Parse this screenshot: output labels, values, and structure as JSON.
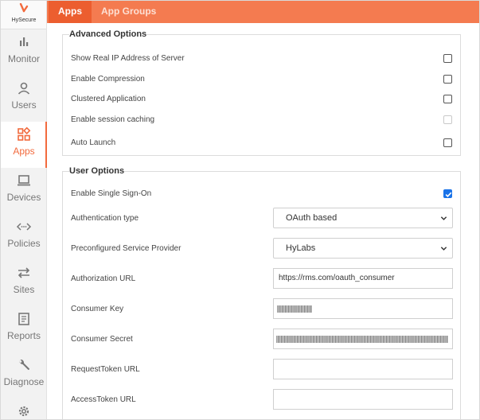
{
  "brand": {
    "name": "HySecure"
  },
  "sidebar": {
    "items": [
      {
        "label": "Monitor",
        "icon": "bar-chart-icon"
      },
      {
        "label": "Users",
        "icon": "user-icon"
      },
      {
        "label": "Apps",
        "icon": "apps-icon",
        "active": true
      },
      {
        "label": "Devices",
        "icon": "laptop-icon"
      },
      {
        "label": "Policies",
        "icon": "code-arrows-icon"
      },
      {
        "label": "Sites",
        "icon": "swap-arrows-icon"
      },
      {
        "label": "Reports",
        "icon": "document-icon"
      },
      {
        "label": "Diagnose",
        "icon": "wrench-icon"
      }
    ]
  },
  "tabs": [
    {
      "label": "Apps",
      "active": true
    },
    {
      "label": "App Groups",
      "active": false
    }
  ],
  "advanced": {
    "title": "Advanced Options",
    "rows": [
      {
        "label": "Show Real IP Address of Server",
        "checked": false,
        "disabled": false
      },
      {
        "label": "Enable Compression",
        "checked": false,
        "disabled": false
      },
      {
        "label": "Clustered Application",
        "checked": false,
        "disabled": false
      },
      {
        "label": "Enable session caching",
        "checked": false,
        "disabled": true
      },
      {
        "label": "Auto Launch",
        "checked": false,
        "disabled": false
      }
    ]
  },
  "user_options": {
    "title": "User Options",
    "sso_label": "Enable Single Sign-On",
    "sso_checked": true,
    "auth_type_label": "Authentication type",
    "auth_type_value": "OAuth based",
    "provider_label": "Preconfigured Service Provider",
    "provider_value": "HyLabs",
    "auth_url_label": "Authorization URL",
    "auth_url_value": "https://rms.com/oauth_consumer",
    "consumer_key_label": "Consumer Key",
    "consumer_secret_label": "Consumer Secret",
    "request_token_label": "RequestToken URL",
    "request_token_value": "",
    "access_token_label": "AccessToken URL",
    "access_token_value": ""
  },
  "colors": {
    "accent": "#f47b50",
    "accent_dark": "#ec5e2f",
    "checkbox_checked": "#1a73e8"
  }
}
